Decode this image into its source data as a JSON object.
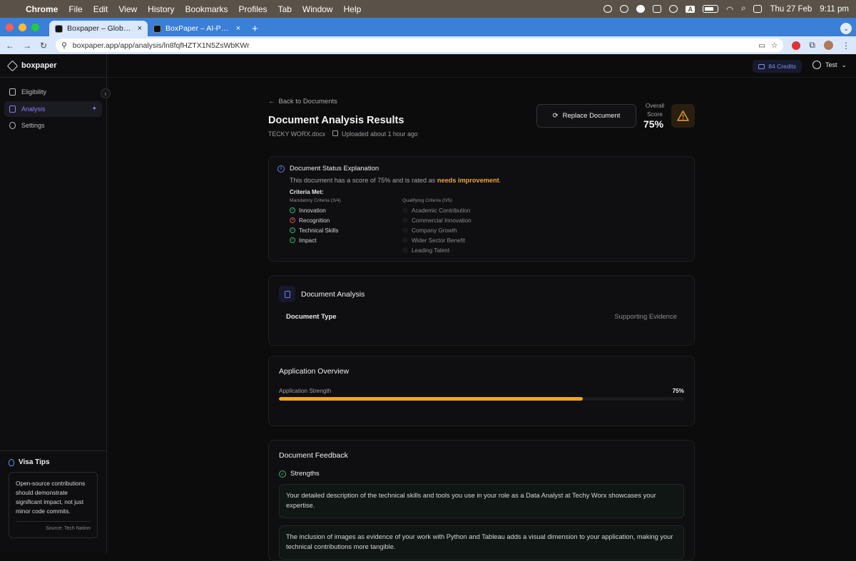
{
  "macbar": {
    "apple": "",
    "menus": [
      "Chrome",
      "File",
      "Edit",
      "View",
      "History",
      "Bookmarks",
      "Profiles",
      "Tab",
      "Window",
      "Help"
    ],
    "date": "Thu 27 Feb",
    "time": "9:11 pm",
    "input_label": "A"
  },
  "browser": {
    "tabs": [
      {
        "title": "Boxpaper – Global Talent Visa"
      },
      {
        "title": "BoxPaper – AI-Powered Document"
      }
    ],
    "new_tab": "+",
    "url": "boxpaper.app/app/analysis/ln8fqfHZTX1N5ZsWbKWr"
  },
  "sidebar": {
    "brand": "boxpaper",
    "items": [
      {
        "label": "Eligibility"
      },
      {
        "label": "Analysis"
      },
      {
        "label": "Settings"
      }
    ],
    "tips": {
      "title": "Visa Tips",
      "text": "Open-source contributions should demonstrate significant impact, not just minor code commits.",
      "source": "Source: Tech Nation"
    }
  },
  "header": {
    "credits": "84 Credits",
    "user": "Test"
  },
  "page": {
    "back": "Back to Documents",
    "title": "Document Analysis Results",
    "filename": "TECKY WORX.docx",
    "uploaded": "Uploaded about 1 hour ago",
    "replace": "Replace Document",
    "score_label": "Overall Score",
    "score": "75%"
  },
  "status": {
    "title": "Document Status Explanation",
    "text_prefix": "This document has a score of 75% and is rated as",
    "rating": "needs improvement",
    "criteria_title": "Criteria Met:",
    "mandatory": {
      "heading": "Mandatory Criteria (3/4)",
      "items": [
        {
          "label": "Innovation",
          "met": true
        },
        {
          "label": "Recognition",
          "met": false
        },
        {
          "label": "Technical Skills",
          "met": true
        },
        {
          "label": "Impact",
          "met": true
        }
      ]
    },
    "qualifying": {
      "heading": "Qualifying Criteria (0/5)",
      "items": [
        {
          "label": "Academic Contribution"
        },
        {
          "label": "Commercial Innovation"
        },
        {
          "label": "Company Growth"
        },
        {
          "label": "Wider Sector Benefit"
        },
        {
          "label": "Leading Talent"
        }
      ]
    }
  },
  "analysis": {
    "title": "Document Analysis",
    "type_key": "Document Type",
    "type_value": "Supporting Evidence"
  },
  "overview": {
    "title": "Application Overview",
    "strength_label": "Application Strength",
    "strength_text": "75%",
    "strength_value": 0.75
  },
  "feedback": {
    "title": "Document Feedback",
    "strengths_label": "Strengths",
    "items": [
      "Your detailed description of the technical skills and tools you use in your role as a Data Analyst at Techy Worx showcases your expertise.",
      "The inclusion of images as evidence of your work with Python and Tableau adds a visual dimension to your application, making your technical contributions more tangible."
    ]
  },
  "colors": {
    "accent": "#8a7cf7",
    "warning": "#f0a33a",
    "progress": "#f5a524",
    "success": "#39b26a",
    "error": "#d94a4a"
  }
}
